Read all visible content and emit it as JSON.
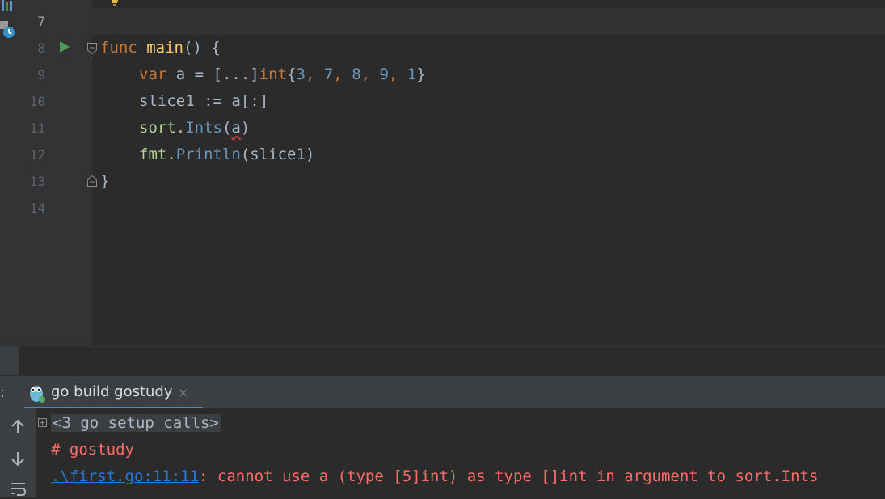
{
  "editor": {
    "lines": [
      {
        "number": "7"
      },
      {
        "number": "8"
      },
      {
        "number": "9"
      },
      {
        "number": "10"
      },
      {
        "number": "11"
      },
      {
        "number": "12"
      },
      {
        "number": "13"
      },
      {
        "number": "14"
      }
    ],
    "code": {
      "l8_kw": "func",
      "l8_fn": "main",
      "l8_rest": "() {",
      "l9_kw": "var",
      "l9_mid": " a = [...]",
      "l9_type": "int",
      "l9_open": "{",
      "l9_n1": "3",
      "l9_n2": "7",
      "l9_n3": "8",
      "l9_n4": "9",
      "l9_n5": "1",
      "l9_close": "}",
      "l10": "slice1 := a[:]",
      "l11_pkg": "sort.",
      "l11_fn": "Ints",
      "l11_open": "(",
      "l11_arg": "a",
      "l11_close": ")",
      "l12_pkg": "fmt.",
      "l12_fn": "Println",
      "l12_args": "(slice1)",
      "l13": "}"
    }
  },
  "run_panel": {
    "tab_label": "go build gostudy",
    "tab_close": "×",
    "left_label": ":"
  },
  "console": {
    "fold_text": "<3 go setup calls>",
    "line2": "# gostudy",
    "error_link": ".\\first.go:11:11",
    "error_msg": ": cannot use a (type [5]int) as type []int in argument to sort.Ints"
  },
  "colors": {
    "keyword": "#cc7832",
    "function": "#ffc66d",
    "number": "#6897bb",
    "error": "#ff6b68",
    "link": "#287bde",
    "tab_underline": "#4a88c7"
  },
  "icons": [
    "run-icon",
    "fold-icon",
    "bulb-icon",
    "gopher-icon",
    "close-icon",
    "arrow-up-icon",
    "arrow-down-icon",
    "soft-wrap-icon",
    "expand-icon"
  ]
}
